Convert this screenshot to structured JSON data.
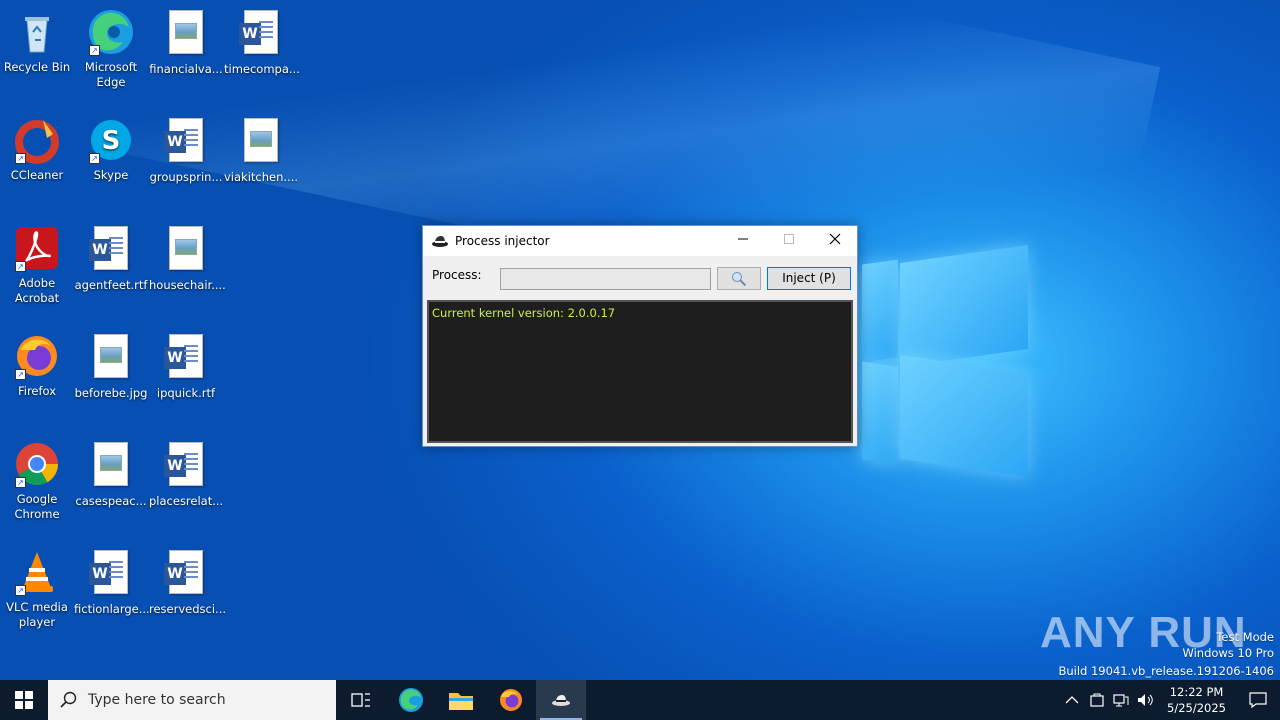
{
  "desktop": {
    "icons": [
      {
        "label": "Recycle Bin",
        "icon": "recycle-bin-icon"
      },
      {
        "label": "Microsoft Edge",
        "icon": "edge-icon"
      },
      {
        "label": "financialva...",
        "icon": "image-file-icon"
      },
      {
        "label": "timecompa...",
        "icon": "word-doc-icon"
      },
      {
        "label": "CCleaner",
        "icon": "ccleaner-icon"
      },
      {
        "label": "Skype",
        "icon": "skype-icon"
      },
      {
        "label": "groupsprin...",
        "icon": "word-doc-icon"
      },
      {
        "label": "viakitchen....",
        "icon": "image-file-icon"
      },
      {
        "label": "Adobe Acrobat",
        "icon": "acrobat-icon"
      },
      {
        "label": "agentfeet.rtf",
        "icon": "word-doc-icon"
      },
      {
        "label": "housechair....",
        "icon": "image-file-icon"
      },
      {
        "label": "Firefox",
        "icon": "firefox-icon"
      },
      {
        "label": "beforebe.jpg",
        "icon": "image-file-icon"
      },
      {
        "label": "ipquick.rtf",
        "icon": "word-doc-icon"
      },
      {
        "label": "Google Chrome",
        "icon": "chrome-icon"
      },
      {
        "label": "casespeac...",
        "icon": "image-file-icon"
      },
      {
        "label": "placesrelat...",
        "icon": "word-doc-icon"
      },
      {
        "label": "VLC media player",
        "icon": "vlc-icon"
      },
      {
        "label": "fictionlarge...",
        "icon": "word-doc-icon"
      },
      {
        "label": "reservedsci...",
        "icon": "word-doc-icon"
      }
    ]
  },
  "window": {
    "title": "Process injector",
    "process_label": "Process:",
    "process_value": "",
    "search_icon": "magnifier-icon",
    "inject_label": "Inject (P)",
    "console_text": "Current kernel version: 2.0.0.17",
    "console_color": "#c8f04a"
  },
  "taskbar": {
    "search_placeholder": "Type here to search",
    "apps": [
      "task-view-icon",
      "edge-icon",
      "file-explorer-icon",
      "firefox-icon",
      "process-injector-icon"
    ],
    "time": "12:22 PM",
    "date": "5/25/2025"
  },
  "watermark": {
    "line1": "Test Mode",
    "line2": "Windows 10 Pro",
    "line3": "Build 19041.vb_release.191206-1406",
    "brand": "ANY RUN"
  },
  "colors": {
    "accent": "#0a60cc",
    "taskbar": "#0c1c2e",
    "console_bg": "#1e1e1e"
  }
}
